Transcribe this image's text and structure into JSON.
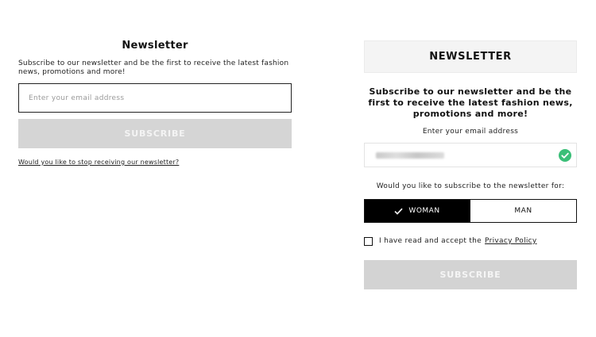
{
  "left_form": {
    "title": "Newsletter",
    "description": "Subscribe to our newsletter and be the first to receive the latest fashion news, promotions and more!",
    "email_placeholder": "Enter your email address",
    "email_value": "",
    "subscribe_label": "SUBSCRIBE",
    "unsubscribe_link": "Would you like to stop receiving our newsletter?"
  },
  "right_form": {
    "header_title": "NEWSLETTER",
    "heading": "Subscribe to our newsletter and be the first to receive the latest fashion news, promotions and more!",
    "email_label": "Enter your email address",
    "email_value": "••••••••••••••",
    "email_valid_icon": "check-circle-icon",
    "gender_question": "Would you like to subscribe to the newsletter for:",
    "gender_options": [
      {
        "label": "WOMAN",
        "selected": true
      },
      {
        "label": "MAN",
        "selected": false
      }
    ],
    "privacy_text": "I have read and accept the",
    "privacy_link": "Privacy Policy",
    "privacy_checked": false,
    "subscribe_label": "SUBSCRIBE"
  },
  "colors": {
    "valid_green": "#3bbf78",
    "disabled_button": "#d5d5d5",
    "selected_bg": "#000000",
    "header_bg": "#f4f4f4"
  }
}
